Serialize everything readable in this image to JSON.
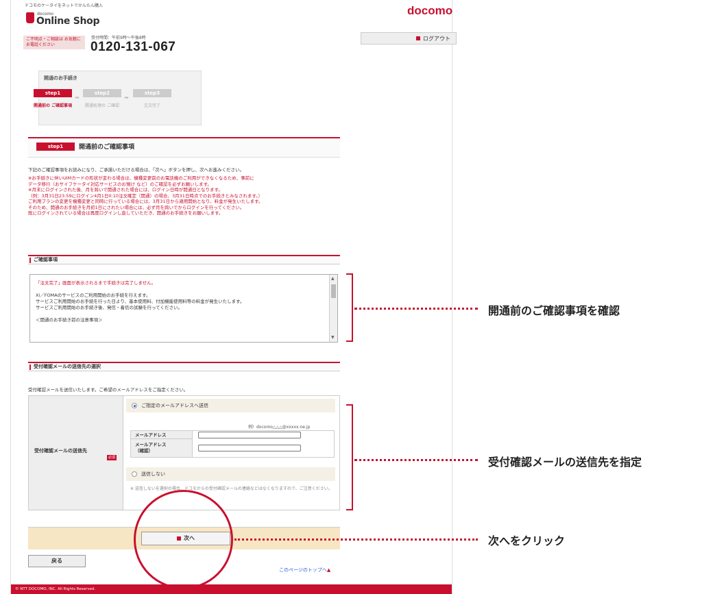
{
  "header": {
    "tagline": "ドコモのケータイをネットでかんたん購入",
    "logo_sub": "docomo",
    "logo_text": "Online Shop",
    "brand": "docomo",
    "contact_label": "ご不明点・ご相談は お気軽にお電話ください",
    "hours": "受付時間：午前9時～午後8時",
    "phone": "0120-131-067",
    "logout_label": "ログアウト"
  },
  "steps": {
    "heading": "開通のお手続き",
    "items": [
      {
        "label": "step1",
        "desc": "開通前の ご確認事項"
      },
      {
        "label": "step2",
        "desc": "開通処理の ご確認"
      },
      {
        "label": "step3",
        "desc": "注文完了"
      }
    ]
  },
  "section": {
    "badge": "step1",
    "title": "開通前のご確認事項",
    "intro": "下記のご確認事項をお読みになり、ご承諾いただける場合は、「次へ」ボタンを押し、次へお進みください。",
    "notes": [
      "※お手続きに伴いUIMカードの形状が変わる場合は、機種変更前のお電話機のご利用ができなくなるため、事前に",
      "データ移行（おサイフケータイ対応サービスのお預け など）のご確認を必ずお願いします。",
      "※月末にログインされた後、月を跨いで開通された場合には、ログイン日時が開通日となります。",
      "（例：3月31日23:59にログイン4月1日0:10注文確定（開通）の場合、3月31日時点でのお手続きとみなされます。）",
      "ご利用プランの変更を機種変更と同時に行っている場合には、3月31日から適用開始となり、料金が発生いたします。",
      "そのため、開通のお手続きを月初1日にされたい場合には、必ず月を跨いでからログインを行ってください。",
      "既にログインされている場合は再度ログインし直していただき、開通のお手続きをお願いします。"
    ]
  },
  "confirm": {
    "heading": "ご確認事項",
    "lines": [
      "「注文完了」画面が表示されるまで手続きは完了しません。",
      "",
      "Xi／FOMAのサービスのご利用開始のお手続を行えます。",
      "サービスご利用開始のお手続を行った日より、基本使用料、付加機能使用料等の料金が発生いたします。",
      "サービスご利用開始のお手続き後、発信・着信の試験を行ってください。",
      "",
      "＜開通のお手続き前の注意事項＞"
    ]
  },
  "mail": {
    "heading": "受付確認メールの送信先の選択",
    "intro": "受付確認メールを送信いたします。ご希望のメールアドレスをご指定ください。",
    "label": "受付確認メールの送信先",
    "required": "必須",
    "option_send": "ご指定のメールアドレスへ送信",
    "example": "例）docomo△△△@xxxxx.ne.jp",
    "address_label": "メールアドレス",
    "confirm_label_1": "メールアドレス",
    "confirm_label_2": "（確認）",
    "option_nosend": "送信しない",
    "note": "※ 送信しないを選択の場合、ドコモからの受付確認メールの連絡などはなくなりますので、ご注意ください。"
  },
  "buttons": {
    "next": "次へ",
    "back": "戻る",
    "top_link": "このページのトップへ"
  },
  "footer": "© NTT DOCOMO, INC. All Rights Reserved.",
  "callouts": {
    "confirm": "開通前のご確認事項を確認",
    "mail": "受付確認メールの送信先を指定",
    "next": "次へをクリック"
  },
  "colors": {
    "accent": "#c8102e",
    "next_bar": "#f7e6c4"
  }
}
